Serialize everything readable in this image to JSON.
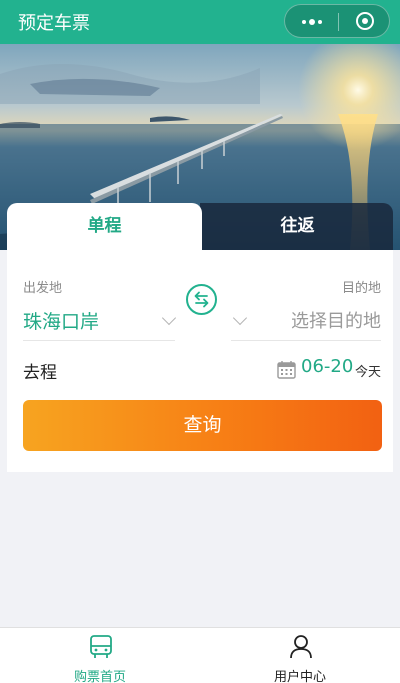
{
  "header": {
    "title": "预定车票"
  },
  "capsule": {
    "more_icon": "more-dots-icon",
    "close_icon": "target-circle-icon"
  },
  "tabs": [
    {
      "label": "单程",
      "active": true
    },
    {
      "label": "往返",
      "active": false
    }
  ],
  "route": {
    "from_label": "出发地",
    "from_value": "珠海口岸",
    "to_label": "目的地",
    "to_placeholder": "选择目的地"
  },
  "trip": {
    "label": "去程",
    "date": "06-20",
    "day": "今天"
  },
  "query_button": "查询",
  "tabbar": [
    {
      "label": "购票首页",
      "icon": "bus-icon",
      "active": true
    },
    {
      "label": "用户中心",
      "icon": "user-icon",
      "active": false
    }
  ],
  "colors": {
    "accent": "#22b28f",
    "accent_text": "#22a986",
    "button_orange": "#f77f15"
  }
}
